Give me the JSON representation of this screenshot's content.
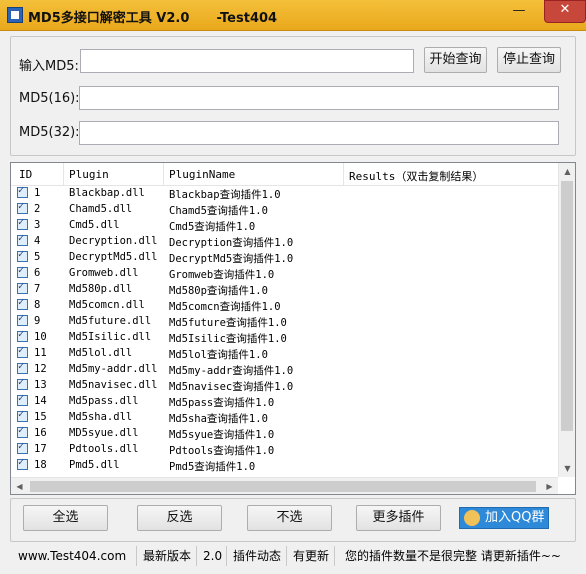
{
  "window": {
    "title": "MD5多接口解密工具 V2.0      -Test404",
    "min_glyph": "—",
    "max_glyph": "☐",
    "close_glyph": "✕"
  },
  "form": {
    "md5_label": "输入MD5:",
    "md5_value": "",
    "md5_16_label": "MD5(16):",
    "md5_16_value": "",
    "md5_32_label": "MD5(32):",
    "md5_32_value": "",
    "start_button": "开始查询",
    "stop_button": "停止查询"
  },
  "grid": {
    "headers": [
      "ID",
      "Plugin",
      "PluginName",
      "Results（双击复制结果）"
    ],
    "rows": [
      {
        "id": "1",
        "plugin": "Blackbap.dll",
        "name": "Blackbap查询插件1.0",
        "checked": true
      },
      {
        "id": "2",
        "plugin": "Chamd5.dll",
        "name": "Chamd5查询插件1.0",
        "checked": true
      },
      {
        "id": "3",
        "plugin": "Cmd5.dll",
        "name": "Cmd5查询插件1.0",
        "checked": true
      },
      {
        "id": "4",
        "plugin": "Decryption.dll",
        "name": "Decryption查询插件1.0",
        "checked": true
      },
      {
        "id": "5",
        "plugin": "DecryptMd5.dll",
        "name": "DecryptMd5查询插件1.0",
        "checked": true
      },
      {
        "id": "6",
        "plugin": "Gromweb.dll",
        "name": "Gromweb查询插件1.0",
        "checked": true
      },
      {
        "id": "7",
        "plugin": "Md580p.dll",
        "name": "Md580p查询插件1.0",
        "checked": true
      },
      {
        "id": "8",
        "plugin": "Md5comcn.dll",
        "name": "Md5comcn查询插件1.0",
        "checked": true
      },
      {
        "id": "9",
        "plugin": "Md5future.dll",
        "name": "Md5future查询插件1.0",
        "checked": true
      },
      {
        "id": "10",
        "plugin": "Md5Isilic.dll",
        "name": "Md5Isilic查询插件1.0",
        "checked": true
      },
      {
        "id": "11",
        "plugin": "Md5lol.dll",
        "name": "Md5lol查询插件1.0",
        "checked": true
      },
      {
        "id": "12",
        "plugin": "Md5my-addr.dll",
        "name": "Md5my-addr查询插件1.0",
        "checked": true
      },
      {
        "id": "13",
        "plugin": "Md5navisec.dll",
        "name": "Md5navisec查询插件1.0",
        "checked": true
      },
      {
        "id": "14",
        "plugin": "Md5pass.dll",
        "name": "Md5pass查询插件1.0",
        "checked": true
      },
      {
        "id": "15",
        "plugin": "Md5sha.dll",
        "name": "Md5sha查询插件1.0",
        "checked": true
      },
      {
        "id": "16",
        "plugin": "MD5syue.dll",
        "name": "Md5syue查询插件1.0",
        "checked": true
      },
      {
        "id": "17",
        "plugin": "Pdtools.dll",
        "name": "Pdtools查询插件1.0",
        "checked": true
      },
      {
        "id": "18",
        "plugin": "Pmd5.dll",
        "name": "Pmd5查询插件1.0",
        "checked": true
      }
    ],
    "scroll_up": "▲",
    "scroll_down": "▼",
    "scroll_left": "◀",
    "scroll_right": "▶"
  },
  "actions": {
    "select_all": "全选",
    "invert": "反选",
    "select_none": "不选",
    "more_plugins": "更多插件",
    "join_qq": "加入QQ群"
  },
  "status": {
    "site": "www.Test404.com",
    "latest_version_label": "最新版本",
    "version": "2.0",
    "plugin_news_label": "插件动态",
    "update_state": "有更新",
    "message": "您的插件数量不是很完整 请更新插件~~"
  }
}
